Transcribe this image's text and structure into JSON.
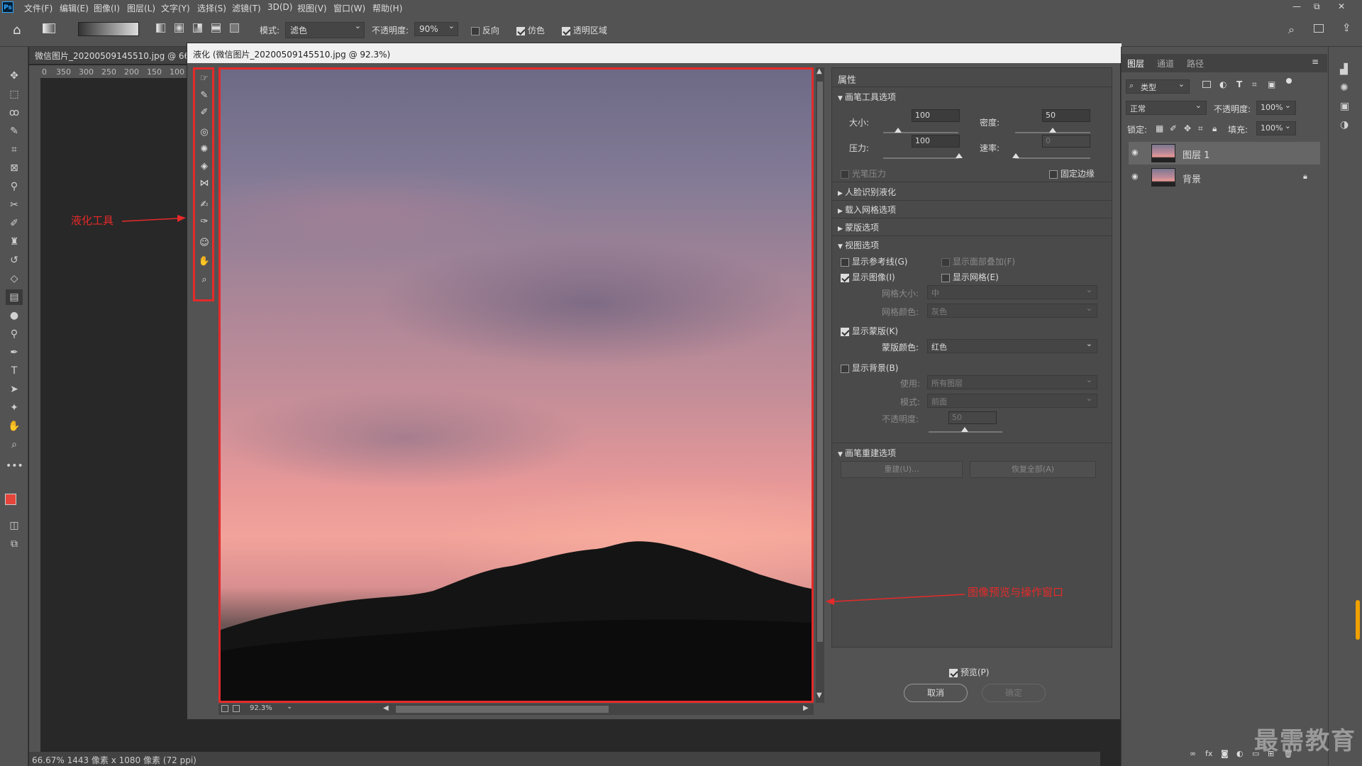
{
  "menu": {
    "logo": "Ps",
    "items": [
      "文件(F)",
      "编辑(E)",
      "图像(I)",
      "图层(L)",
      "文字(Y)",
      "选择(S)",
      "滤镜(T)",
      "3D(D)",
      "视图(V)",
      "窗口(W)",
      "帮助(H)"
    ],
    "window_controls": [
      "—",
      "⧉",
      "✕"
    ]
  },
  "options_bar": {
    "mode_label": "模式:",
    "mode_value": "滤色",
    "opacity_label": "不透明度:",
    "opacity_value": "90%",
    "reverse_label": "反向",
    "reverse_checked": false,
    "dither_label": "仿色",
    "dither_checked": true,
    "transparency_label": "透明区域",
    "transparency_checked": true
  },
  "document": {
    "tab_title": "微信图片_20200509145510.jpg @ 66",
    "ruler_ticks": [
      "0",
      "350",
      "300",
      "250",
      "200",
      "150",
      "100"
    ],
    "status": "66.67%  1443 像素 x 1080 像素 (72 ppi)"
  },
  "dialog": {
    "title": "液化 (微信图片_20200509145510.jpg @ 92.3%)",
    "zoom_value": "92.3%",
    "annotation_tools": "液化工具",
    "annotation_preview": "图像预览与操作窗口",
    "properties": {
      "header": "属性",
      "brush_section": "画笔工具选项",
      "size_label": "大小:",
      "size_value": "100",
      "density_label": "密度:",
      "density_value": "50",
      "pressure_label": "压力:",
      "pressure_value": "100",
      "rate_label": "速率:",
      "rate_value": "0",
      "stylus_label": "光笔压力",
      "pin_edges_label": "固定边缘",
      "face_section": "人脸识别液化",
      "load_mesh_section": "载入网格选项",
      "mask_section": "蒙版选项",
      "view_section": "视图选项",
      "show_guides": "显示参考线(G)",
      "show_face_overlay": "显示面部叠加(F)",
      "show_image": "显示图像(I)",
      "show_mesh": "显示网格(E)",
      "mesh_size_label": "网格大小:",
      "mesh_size_value": "中",
      "mesh_color_label": "网格颜色:",
      "mesh_color_value": "灰色",
      "show_mask": "显示蒙版(K)",
      "mask_color_label": "蒙版颜色:",
      "mask_color_value": "红色",
      "show_backdrop": "显示背景(B)",
      "use_label": "使用:",
      "use_value": "所有图层",
      "mode_label": "模式:",
      "mode_value": "前面",
      "opacity_label": "不透明度:",
      "opacity_value": "50",
      "reconstruct_section": "画笔重建选项",
      "reconstruct_btn": "重建(U)...",
      "restore_all_btn": "恢复全部(A)"
    },
    "preview_label": "预览(P)",
    "cancel_btn": "取消",
    "ok_btn": "确定"
  },
  "layers_panel": {
    "tabs": [
      "图层",
      "通道",
      "路径"
    ],
    "filter_value": "类型",
    "blend_value": "正常",
    "opacity_label": "不透明度:",
    "opacity_value": "100%",
    "lock_label": "锁定:",
    "fill_label": "填充:",
    "fill_value": "100%",
    "layers": [
      {
        "name": "图层 1",
        "active": true
      },
      {
        "name": "背景",
        "active": false
      }
    ]
  },
  "watermark": "最需教育",
  "colors": {
    "accent_red": "#e52a2a",
    "foreground": "#e5453a",
    "background": "#ffffff"
  }
}
